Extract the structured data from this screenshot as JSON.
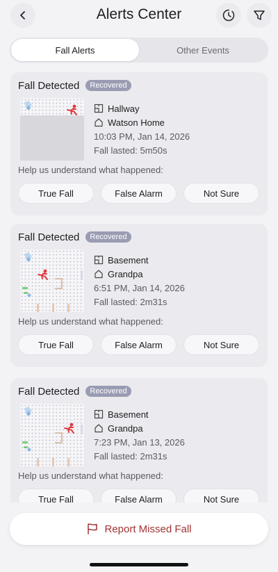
{
  "header": {
    "title": "Alerts Center",
    "back_icon": "chevron-left-icon",
    "history_icon": "history-clock-icon",
    "filter_icon": "filter-funnel-icon"
  },
  "tabs": [
    {
      "label": "Fall Alerts",
      "active": true
    },
    {
      "label": "Other Events",
      "active": false
    }
  ],
  "alerts": [
    {
      "title": "Fall Detected",
      "badge": "Recovered",
      "room": "Hallway",
      "home": "Watson Home",
      "datetime": "10:03 PM, Jan 14, 2026",
      "duration": "Fall lasted: 5m50s",
      "prompt": "Help us understand what happened:",
      "actions": [
        "True Fall",
        "False Alarm",
        "Not Sure"
      ]
    },
    {
      "title": "Fall Detected",
      "badge": "Recovered",
      "room": "Basement",
      "home": "Grandpa",
      "datetime": "6:51 PM, Jan 14, 2026",
      "duration": "Fall lasted: 2m31s",
      "prompt": "Help us understand what happened:",
      "actions": [
        "True Fall",
        "False Alarm",
        "Not Sure"
      ]
    },
    {
      "title": "Fall Detected",
      "badge": "Recovered",
      "room": "Basement",
      "home": "Grandpa",
      "datetime": "7:23 PM, Jan 13, 2026",
      "duration": "Fall lasted: 2m31s",
      "prompt": "Help us understand what happened:",
      "actions": [
        "True Fall",
        "False Alarm",
        "Not Sure"
      ]
    }
  ],
  "footer": {
    "report_label": "Report Missed Fall",
    "report_icon": "flag-icon"
  },
  "colors": {
    "accent_red": "#a23232",
    "badge": "#9a9cb3",
    "fall_figure": "#e0393e"
  }
}
